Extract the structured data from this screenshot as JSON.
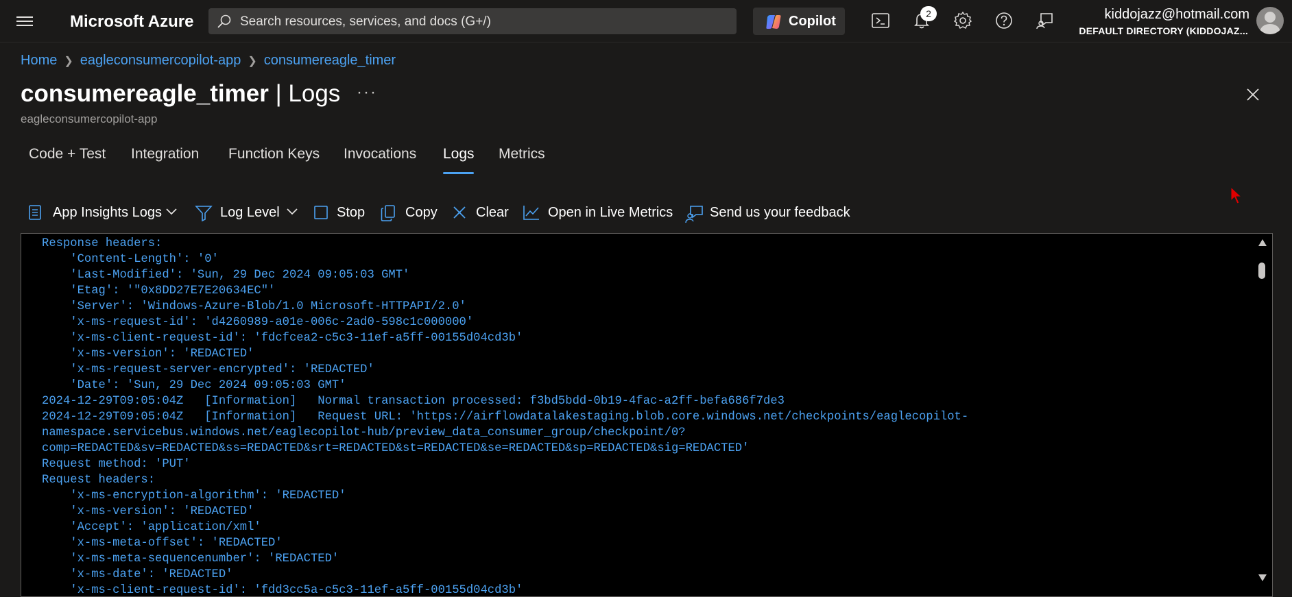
{
  "topbar": {
    "brand": "Microsoft Azure",
    "search_placeholder": "Search resources, services, and docs (G+/)",
    "copilot_label": "Copilot",
    "notifications_count": "2",
    "user_email": "kiddojazz@hotmail.com",
    "user_directory": "DEFAULT DIRECTORY (KIDDOJAZ..."
  },
  "breadcrumb": [
    "Home",
    "eagleconsumercopilot-app",
    "consumereagle_timer"
  ],
  "page": {
    "title_name": "consumereagle_timer",
    "title_separator": "|",
    "title_section": "Logs",
    "more": "···",
    "subtitle": "eagleconsumercopilot-app"
  },
  "tabs": [
    {
      "label": "Code + Test",
      "active": false
    },
    {
      "label": "Integration",
      "active": false
    },
    {
      "label": "Function Keys",
      "active": false
    },
    {
      "label": "Invocations",
      "active": false
    },
    {
      "label": "Logs",
      "active": true
    },
    {
      "label": "Metrics",
      "active": false
    }
  ],
  "toolbar": {
    "app_insights_logs": "App Insights Logs",
    "log_level": "Log Level",
    "stop": "Stop",
    "copy": "Copy",
    "clear": "Clear",
    "open_live_metrics": "Open in Live Metrics",
    "feedback": "Send us your feedback"
  },
  "log_lines": [
    "Response headers:",
    "    'Content-Length': '0'",
    "    'Last-Modified': 'Sun, 29 Dec 2024 09:05:03 GMT'",
    "    'Etag': '\"0x8DD27E7E20634EC\"'",
    "    'Server': 'Windows-Azure-Blob/1.0 Microsoft-HTTPAPI/2.0'",
    "    'x-ms-request-id': 'd4260989-a01e-006c-2ad0-598c1c000000'",
    "    'x-ms-client-request-id': 'fdcfcea2-c5c3-11ef-a5ff-00155d04cd3b'",
    "    'x-ms-version': 'REDACTED'",
    "    'x-ms-request-server-encrypted': 'REDACTED'",
    "    'Date': 'Sun, 29 Dec 2024 09:05:03 GMT'",
    "2024-12-29T09:05:04Z   [Information]   Normal transaction processed: f3bd5bdd-0b19-4fac-a2ff-befa686f7de3",
    "2024-12-29T09:05:04Z   [Information]   Request URL: 'https://airflowdatalakestaging.blob.core.windows.net/checkpoints/eaglecopilot-",
    "namespace.servicebus.windows.net/eaglecopilot-hub/preview_data_consumer_group/checkpoint/0?",
    "comp=REDACTED&sv=REDACTED&ss=REDACTED&srt=REDACTED&st=REDACTED&se=REDACTED&sp=REDACTED&sig=REDACTED'",
    "Request method: 'PUT'",
    "Request headers:",
    "    'x-ms-encryption-algorithm': 'REDACTED'",
    "    'x-ms-version': 'REDACTED'",
    "    'Accept': 'application/xml'",
    "    'x-ms-meta-offset': 'REDACTED'",
    "    'x-ms-meta-sequencenumber': 'REDACTED'",
    "    'x-ms-date': 'REDACTED'",
    "    'x-ms-client-request-id': 'fdd3cc5a-c5c3-11ef-a5ff-00155d04cd3b'"
  ],
  "colors": {
    "background": "#1b1a19",
    "accent": "#4ca2f2",
    "console_bg": "#000000",
    "log_text": "#4ca2f2"
  }
}
